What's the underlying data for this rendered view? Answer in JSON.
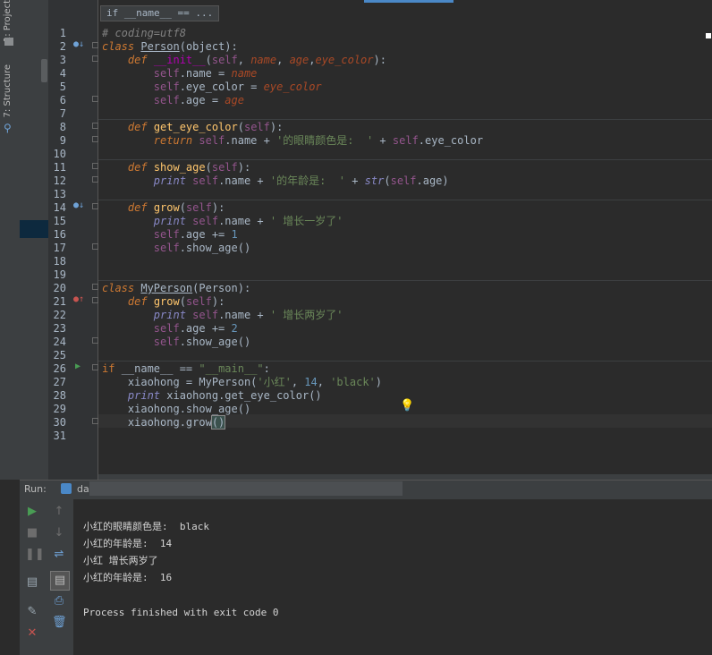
{
  "tool_windows": {
    "project_tab": "1: Project",
    "structure_tab": "7: Structure"
  },
  "editor": {
    "breadcrumb": "if __name__ == ...",
    "lines": [
      {
        "n": "1",
        "segs": [
          {
            "c": "cmt",
            "t": "# coding=utf8"
          }
        ]
      },
      {
        "n": "2",
        "segs": [
          {
            "c": "kw",
            "t": "class "
          },
          {
            "c": "cls",
            "t": "Person"
          },
          {
            "c": "",
            "t": "(object):"
          }
        ]
      },
      {
        "n": "3",
        "segs": [
          {
            "c": "",
            "t": "    "
          },
          {
            "c": "kw",
            "t": "def "
          },
          {
            "c": "magic",
            "t": "__init__"
          },
          {
            "c": "",
            "t": "("
          },
          {
            "c": "self",
            "t": "self"
          },
          {
            "c": "",
            "t": ", "
          },
          {
            "c": "param",
            "t": "name"
          },
          {
            "c": "",
            "t": ", "
          },
          {
            "c": "param",
            "t": "age"
          },
          {
            "c": "",
            "t": ","
          },
          {
            "c": "param",
            "t": "eye_color"
          },
          {
            "c": "",
            "t": "):"
          }
        ]
      },
      {
        "n": "4",
        "segs": [
          {
            "c": "",
            "t": "        "
          },
          {
            "c": "self",
            "t": "self"
          },
          {
            "c": "",
            "t": ".name = "
          },
          {
            "c": "param",
            "t": "name"
          }
        ]
      },
      {
        "n": "5",
        "segs": [
          {
            "c": "",
            "t": "        "
          },
          {
            "c": "self",
            "t": "self"
          },
          {
            "c": "",
            "t": ".eye_color = "
          },
          {
            "c": "param",
            "t": "eye_color"
          }
        ]
      },
      {
        "n": "6",
        "segs": [
          {
            "c": "",
            "t": "        "
          },
          {
            "c": "self",
            "t": "self"
          },
          {
            "c": "",
            "t": ".age = "
          },
          {
            "c": "param",
            "t": "age"
          }
        ]
      },
      {
        "n": "7",
        "segs": []
      },
      {
        "n": "8",
        "segs": [
          {
            "c": "",
            "t": "    "
          },
          {
            "c": "kw",
            "t": "def "
          },
          {
            "c": "def",
            "t": "get_eye_color"
          },
          {
            "c": "",
            "t": "("
          },
          {
            "c": "self",
            "t": "self"
          },
          {
            "c": "",
            "t": "):"
          }
        ]
      },
      {
        "n": "9",
        "segs": [
          {
            "c": "",
            "t": "        "
          },
          {
            "c": "kw",
            "t": "return "
          },
          {
            "c": "self",
            "t": "self"
          },
          {
            "c": "",
            "t": ".name + "
          },
          {
            "c": "str",
            "t": "'的眼睛颜色是:  '"
          },
          {
            "c": "",
            "t": " + "
          },
          {
            "c": "self",
            "t": "self"
          },
          {
            "c": "",
            "t": ".eye_color"
          }
        ]
      },
      {
        "n": "10",
        "segs": []
      },
      {
        "n": "11",
        "segs": [
          {
            "c": "",
            "t": "    "
          },
          {
            "c": "kw",
            "t": "def "
          },
          {
            "c": "def",
            "t": "show_age"
          },
          {
            "c": "",
            "t": "("
          },
          {
            "c": "self",
            "t": "self"
          },
          {
            "c": "",
            "t": "):"
          }
        ]
      },
      {
        "n": "12",
        "segs": [
          {
            "c": "",
            "t": "        "
          },
          {
            "c": "prt",
            "t": "print "
          },
          {
            "c": "self",
            "t": "self"
          },
          {
            "c": "",
            "t": ".name + "
          },
          {
            "c": "str",
            "t": "'的年龄是:  '"
          },
          {
            "c": "",
            "t": " + "
          },
          {
            "c": "prt",
            "t": "str"
          },
          {
            "c": "",
            "t": "("
          },
          {
            "c": "self",
            "t": "self"
          },
          {
            "c": "",
            "t": ".age)"
          }
        ]
      },
      {
        "n": "13",
        "segs": []
      },
      {
        "n": "14",
        "segs": [
          {
            "c": "",
            "t": "    "
          },
          {
            "c": "kw",
            "t": "def "
          },
          {
            "c": "def",
            "t": "grow"
          },
          {
            "c": "",
            "t": "("
          },
          {
            "c": "self",
            "t": "self"
          },
          {
            "c": "",
            "t": "):"
          }
        ]
      },
      {
        "n": "15",
        "segs": [
          {
            "c": "",
            "t": "        "
          },
          {
            "c": "prt",
            "t": "print "
          },
          {
            "c": "self",
            "t": "self"
          },
          {
            "c": "",
            "t": ".name + "
          },
          {
            "c": "str",
            "t": "' 增长一岁了'"
          }
        ]
      },
      {
        "n": "16",
        "segs": [
          {
            "c": "",
            "t": "        "
          },
          {
            "c": "self",
            "t": "self"
          },
          {
            "c": "",
            "t": ".age += "
          },
          {
            "c": "num",
            "t": "1"
          }
        ]
      },
      {
        "n": "17",
        "segs": [
          {
            "c": "",
            "t": "        "
          },
          {
            "c": "self",
            "t": "self"
          },
          {
            "c": "",
            "t": ".show_age()"
          }
        ]
      },
      {
        "n": "18",
        "segs": []
      },
      {
        "n": "19",
        "segs": []
      },
      {
        "n": "20",
        "segs": [
          {
            "c": "kw",
            "t": "class "
          },
          {
            "c": "cls",
            "t": "MyPerson"
          },
          {
            "c": "",
            "t": "(Person):"
          }
        ]
      },
      {
        "n": "21",
        "segs": [
          {
            "c": "",
            "t": "    "
          },
          {
            "c": "kw",
            "t": "def "
          },
          {
            "c": "def",
            "t": "grow"
          },
          {
            "c": "",
            "t": "("
          },
          {
            "c": "self",
            "t": "self"
          },
          {
            "c": "",
            "t": "):"
          }
        ]
      },
      {
        "n": "22",
        "segs": [
          {
            "c": "",
            "t": "        "
          },
          {
            "c": "prt",
            "t": "print "
          },
          {
            "c": "self",
            "t": "self"
          },
          {
            "c": "",
            "t": ".name + "
          },
          {
            "c": "str",
            "t": "' 增长两岁了'"
          }
        ]
      },
      {
        "n": "23",
        "segs": [
          {
            "c": "",
            "t": "        "
          },
          {
            "c": "self",
            "t": "self"
          },
          {
            "c": "",
            "t": ".age += "
          },
          {
            "c": "num",
            "t": "2"
          }
        ]
      },
      {
        "n": "24",
        "segs": [
          {
            "c": "",
            "t": "        "
          },
          {
            "c": "self",
            "t": "self"
          },
          {
            "c": "",
            "t": ".show_age()"
          }
        ]
      },
      {
        "n": "25",
        "segs": []
      },
      {
        "n": "26",
        "segs": [
          {
            "c": "kw2",
            "t": "if "
          },
          {
            "c": "",
            "t": "__name__ == "
          },
          {
            "c": "str",
            "t": "\"__main__\""
          },
          {
            "c": "",
            "t": ":"
          }
        ]
      },
      {
        "n": "27",
        "segs": [
          {
            "c": "",
            "t": "    xiaohong = MyPerson("
          },
          {
            "c": "str",
            "t": "'小红'"
          },
          {
            "c": "",
            "t": ", "
          },
          {
            "c": "num",
            "t": "14"
          },
          {
            "c": "",
            "t": ", "
          },
          {
            "c": "str",
            "t": "'black'"
          },
          {
            "c": "",
            "t": ")"
          }
        ]
      },
      {
        "n": "28",
        "segs": [
          {
            "c": "",
            "t": "    "
          },
          {
            "c": "prt",
            "t": "print "
          },
          {
            "c": "",
            "t": "xiaohong.get_eye_color()"
          }
        ]
      },
      {
        "n": "29",
        "segs": [
          {
            "c": "",
            "t": "    xiaohong.show_age()"
          }
        ]
      },
      {
        "n": "30",
        "segs": [
          {
            "c": "",
            "t": "    xiaohong.grow"
          },
          {
            "c": "cur",
            "t": "()"
          }
        ]
      },
      {
        "n": "31",
        "segs": []
      }
    ]
  },
  "run": {
    "label": "Run:",
    "tab_visible": "da",
    "output": [
      "小红的眼睛颜色是:  black",
      "小红的年龄是:  14",
      "小红 增长两岁了",
      "小红的年龄是:  16",
      "",
      "Process finished with exit code 0"
    ]
  },
  "colors": {
    "run_green": "#499c54",
    "stop_red": "#c75450",
    "accent_blue": "#4a88c7"
  }
}
